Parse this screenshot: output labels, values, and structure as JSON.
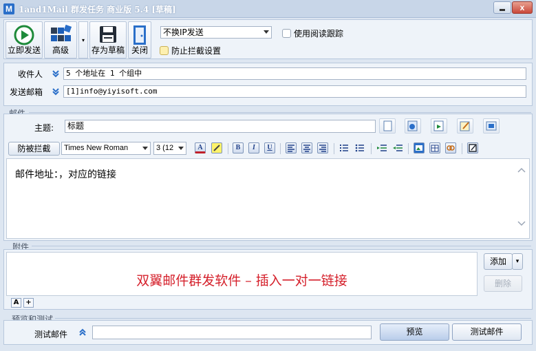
{
  "window": {
    "logo_letter": "M",
    "title": "1and1Mail 群发任务 商业版 5.4 [草稿]",
    "close_symbol": "x"
  },
  "toolbar": {
    "send_now": "立即发送",
    "advanced": "高级",
    "save_draft": "存为草稿",
    "close": "关闭",
    "split_arrow": "▾",
    "ip_mode": "不换IP发送",
    "read_tracking": "使用阅读跟踪",
    "anti_block": "防止拦截设置"
  },
  "recipients": {
    "to_label": "收件人",
    "to_value": "5 个地址在 1 个组中",
    "from_label": "发送邮箱",
    "from_value": "[1]info@yiyisoft.com"
  },
  "mail": {
    "group_label": "邮件",
    "subject_label": "主题:",
    "subject_value": "标题"
  },
  "format_bar": {
    "anti_block_button": "防被拦截",
    "font_name": "Times New Roman",
    "font_size": "3 (12",
    "font_color": "A",
    "bold": "B",
    "italic": "I",
    "underline": "U"
  },
  "editor": {
    "body_text": "邮件地址：，对应的链接"
  },
  "attachments": {
    "group_label": "附件",
    "banner": "双翼邮件群发软件 – 插入一对一链接",
    "add_button": "添加",
    "add_arrow": "▾",
    "delete_button": "删除",
    "small_a": "A",
    "small_plus": "+"
  },
  "preview": {
    "group_label": "预览和测试",
    "test_mail_label": "测试邮件",
    "test_mail_value": "",
    "preview_button": "预览",
    "test_mail_button": "测试邮件"
  },
  "colors": {
    "accent": "#2a6fc9",
    "banner_red": "#d5202b",
    "send_green": "#1e8a3a",
    "panel_bg": "#eef3f9",
    "window_bg": "#dde6f1"
  },
  "icons": [
    "play-icon",
    "grid-icon",
    "save-icon",
    "door-icon",
    "chevron-down-icon",
    "chevron-up-icon",
    "document-icon",
    "web-icon",
    "import-icon",
    "edit-icon",
    "image-icon"
  ]
}
